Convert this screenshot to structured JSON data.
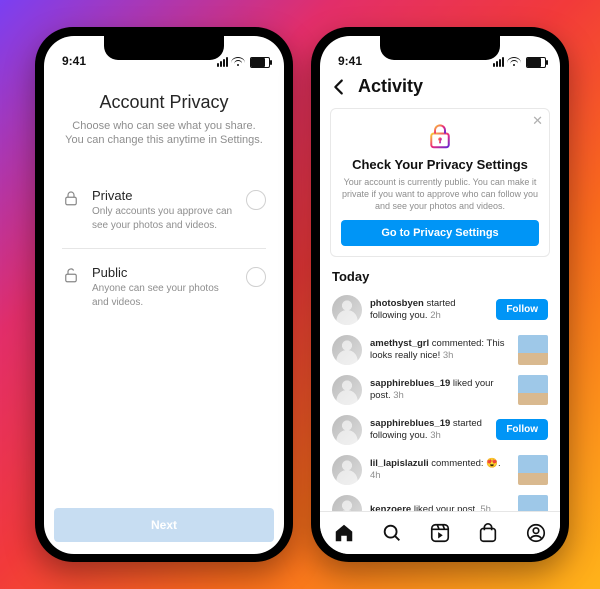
{
  "status": {
    "time": "9:41"
  },
  "left": {
    "title": "Account Privacy",
    "subtitle": "Choose who can see what you share. You can change this anytime in Settings.",
    "options": {
      "private": {
        "label": "Private",
        "desc": "Only accounts you approve can see your photos and videos."
      },
      "public": {
        "label": "Public",
        "desc": "Anyone can see your photos and videos."
      }
    },
    "next": "Next"
  },
  "right": {
    "header": "Activity",
    "card": {
      "title": "Check Your Privacy Settings",
      "body": "Your account is currently public. You can make it private if you want to approve who can follow you and see your photos and videos.",
      "cta": "Go to Privacy Settings"
    },
    "sectionToday": "Today",
    "followLabel": "Follow",
    "feed": [
      {
        "user": "photosbyen",
        "text": " started following you. ",
        "time": "2h",
        "action": "follow"
      },
      {
        "user": "amethyst_grl",
        "text": " commented: This looks really nice! ",
        "time": "3h",
        "action": "thumb"
      },
      {
        "user": "sapphireblues_19",
        "text": " liked your post. ",
        "time": "3h",
        "action": "thumb"
      },
      {
        "user": "sapphireblues_19",
        "text": " started following you. ",
        "time": "3h",
        "action": "follow"
      },
      {
        "user": "lil_lapislazuli",
        "text": " commented: 😍. ",
        "time": "4h",
        "action": "thumb"
      },
      {
        "user": "kenzoere",
        "text": " liked your post. ",
        "time": "5h",
        "action": "thumb"
      }
    ]
  }
}
